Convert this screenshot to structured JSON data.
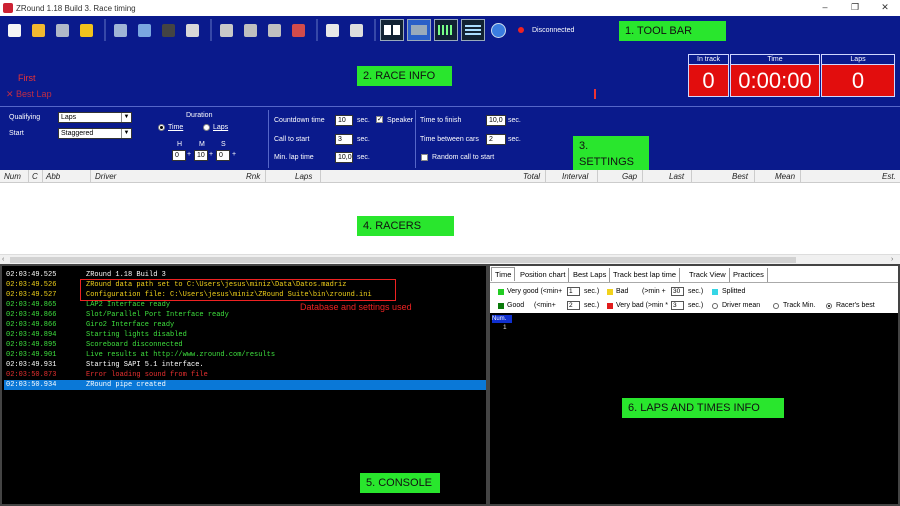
{
  "window": {
    "title": "ZRound 1.18 Build 3. Race timing",
    "controls": [
      "–",
      "❐",
      "✕"
    ]
  },
  "toolbar": {
    "status": "Disconnected",
    "icons": [
      {
        "name": "new-file-icon",
        "color": "#f5f5f5"
      },
      {
        "name": "open-folder-icon",
        "color": "#f2b830"
      },
      {
        "name": "save-icon",
        "color": "#b0b8c8"
      },
      {
        "name": "race-wizard-icon",
        "color": "#f2c21b"
      },
      {
        "name": "monitor-icon",
        "color": "#9fb5d6"
      },
      {
        "name": "database-icon",
        "color": "#7aa7e0"
      },
      {
        "name": "clapperboard-icon",
        "color": "#444"
      },
      {
        "name": "printer-icon",
        "color": "#d8d8d8"
      },
      {
        "name": "car-settings-icon",
        "color": "#c8c8c8"
      },
      {
        "name": "track-settings-icon",
        "color": "#bfbfbf"
      },
      {
        "name": "lane-settings-icon",
        "color": "#c0c0c0"
      },
      {
        "name": "driver-settings-icon",
        "color": "#d24b4b"
      },
      {
        "name": "stopwatch-icon",
        "color": "#e8e8e8"
      },
      {
        "name": "checkered-flag-icon",
        "color": "#dddddd"
      }
    ]
  },
  "annotations": {
    "toolbar": "1. TOOL BAR",
    "race_info": "2. RACE INFO",
    "settings": "3. SETTINGS",
    "racers": "4. RACERS",
    "console": "5. CONSOLE",
    "laps": "6. LAPS AND TIMES INFO",
    "db_note": "Database and settings used"
  },
  "race_info": {
    "first_label": "First",
    "best_lap_label": "Best Lap",
    "scoreboard": [
      {
        "label": "In track",
        "value": "0"
      },
      {
        "label": "Time",
        "value": "0:00:00"
      },
      {
        "label": "Laps",
        "value": "0"
      }
    ]
  },
  "settings": {
    "qualifying_label": "Qualifying",
    "qualifying_value": "Laps",
    "start_label": "Start",
    "start_value": "Staggered",
    "duration_label": "Duration",
    "duration_time_label": "Time",
    "duration_laps_label": "Laps",
    "h_label": "H",
    "m_label": "M",
    "s_label": "S",
    "hours": "0",
    "minutes": "10",
    "seconds": "0",
    "countdown_label": "Countdown time",
    "countdown_value": "10",
    "call_to_start_label": "Call to start",
    "call_to_start_value": "3",
    "min_lap_label": "Min. lap time",
    "min_lap_value": "10,0",
    "sec_unit": "sec.",
    "speaker_label": "Speaker",
    "time_to_finish_label": "Time to finish",
    "time_to_finish_value": "10,0",
    "time_between_cars_label": "Time between cars",
    "time_between_cars_value": "2",
    "random_call_label": "Random call to start"
  },
  "racers": {
    "columns": [
      "Num",
      "C",
      "Abb",
      "Driver",
      "Rnk",
      "Laps",
      "Total",
      "Interval",
      "Gap",
      "Last",
      "Best",
      "Mean",
      "Est."
    ]
  },
  "console": {
    "lines": [
      {
        "time": "02:03:49.525",
        "msg": "ZRound 1.18 Build 3",
        "color": "#ffffff"
      },
      {
        "time": "02:03:49.526",
        "msg": "ZRound data path set to C:\\Users\\jesus\\miniz\\Data\\Datos.madriz",
        "color": "#f2d21b"
      },
      {
        "time": "02:03:49.527",
        "msg": "Configuration file: C:\\Users\\jesus\\miniz\\ZRound Suite\\bin\\zround.ini",
        "color": "#f2d21b"
      },
      {
        "time": "02:03:49.865",
        "msg": "LAP2 Interface ready",
        "color": "#3ee03e"
      },
      {
        "time": "02:03:49.866",
        "msg": "Slot/Parallel Port Interface ready",
        "color": "#3ee03e"
      },
      {
        "time": "02:03:49.866",
        "msg": "Giro2 Interface ready",
        "color": "#3ee03e"
      },
      {
        "time": "02:03:49.894",
        "msg": "Starting lights disabled",
        "color": "#3ee03e"
      },
      {
        "time": "02:03:49.895",
        "msg": "Scoreboard disconnected",
        "color": "#3ee03e"
      },
      {
        "time": "02:03:49.901",
        "msg": "Live results at http://www.zround.com/results",
        "color": "#3ee03e"
      },
      {
        "time": "02:03:49.931",
        "msg": "Starting SAPI 5.1 interface.",
        "color": "#ffffff"
      },
      {
        "time": "02:03:50.873",
        "msg": "Error loading sound from file",
        "color": "#e83030"
      },
      {
        "time": "02:03:50.934",
        "msg": "ZRound pipe created",
        "color": "#ffffff"
      }
    ]
  },
  "laps": {
    "tabs": [
      "Time",
      "Position chart",
      "Best Laps",
      "Track best lap time",
      "Track View",
      "Practices"
    ],
    "very_good_label": "Very good (<min+",
    "very_good_value": "1",
    "good_label": "Good",
    "good_prefix": "(<min+",
    "good_value": "2",
    "bad_label": "Bad",
    "bad_prefix": "(>min +",
    "bad_value": "30",
    "very_bad_label": "Very bad (>min *",
    "very_bad_value": "3",
    "splitted_label": "Splitted",
    "sec_unit": "sec.)",
    "driver_mean_label": "Driver mean",
    "track_min_label": "Track Min.",
    "racers_best_label": "Racer's best",
    "num_header": "Num.",
    "first_row_num": "1",
    "colors": {
      "very_good": "#22cc22",
      "good": "#0a7a0a",
      "bad": "#f2d21b",
      "very_bad": "#e01c1c",
      "splitted": "#35d6e6"
    }
  }
}
